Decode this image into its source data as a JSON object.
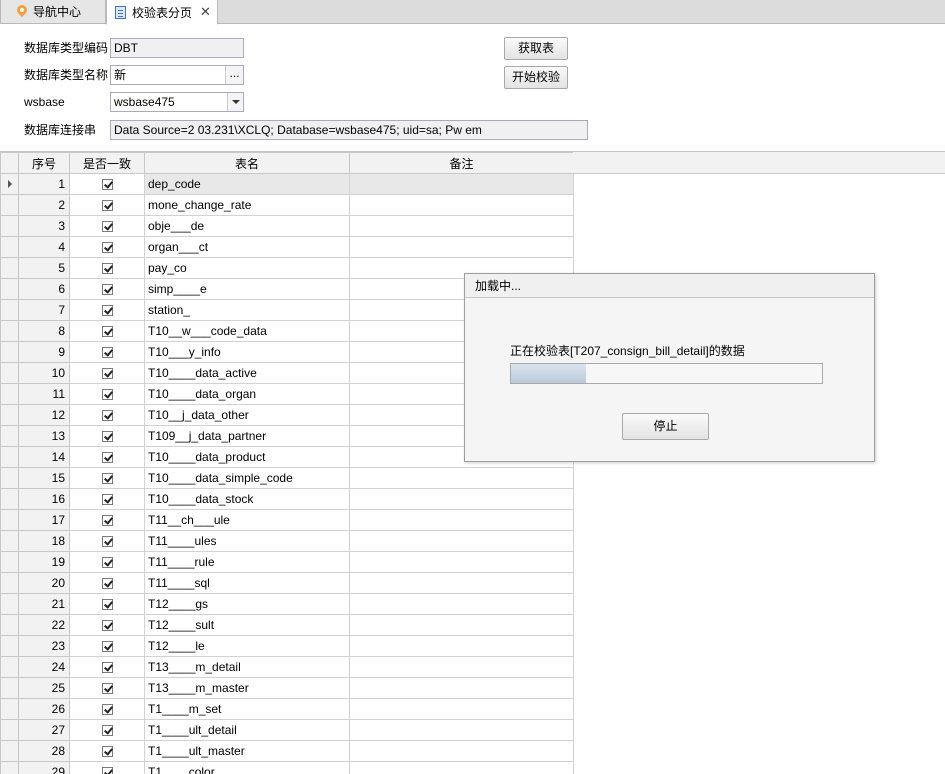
{
  "tabs": [
    {
      "label": "导航中心",
      "icon": "location-pin-icon",
      "active": false
    },
    {
      "label": "校验表分页",
      "icon": "document-icon",
      "active": true,
      "close": "✕"
    }
  ],
  "form": {
    "db_type_code_label": "数据库类型编码",
    "db_type_code_value": "DBT",
    "db_type_name_label": "数据库类型名称",
    "db_type_name_value": "新",
    "ellipsis": "...",
    "wsbase_label": "wsbase",
    "wsbase_value": "wsbase475",
    "conn_label": "数据库连接串",
    "conn_value": "Data Source=2          03.231\\XCLQ; Database=wsbase475; uid=sa; Pw           em",
    "get_tables_button": "获取表",
    "start_check_button": "开始校验"
  },
  "grid": {
    "columns": [
      "序号",
      "是否一致",
      "表名",
      "备注"
    ],
    "rows": [
      {
        "seq": "1",
        "name": "dep_code"
      },
      {
        "seq": "2",
        "name": "mone_change_rate"
      },
      {
        "seq": "3",
        "name": "obje___de"
      },
      {
        "seq": "4",
        "name": "organ___ct"
      },
      {
        "seq": "5",
        "name": "pay_co"
      },
      {
        "seq": "6",
        "name": "simp____e"
      },
      {
        "seq": "7",
        "name": "station_"
      },
      {
        "seq": "8",
        "name": "T10__w___code_data"
      },
      {
        "seq": "9",
        "name": "T10___y_info"
      },
      {
        "seq": "10",
        "name": "T10____data_active"
      },
      {
        "seq": "11",
        "name": "T10____data_organ"
      },
      {
        "seq": "12",
        "name": "T10__j_data_other"
      },
      {
        "seq": "13",
        "name": "T109__j_data_partner"
      },
      {
        "seq": "14",
        "name": "T10____data_product"
      },
      {
        "seq": "15",
        "name": "T10____data_simple_code"
      },
      {
        "seq": "16",
        "name": "T10____data_stock"
      },
      {
        "seq": "17",
        "name": "T11__ch___ule"
      },
      {
        "seq": "18",
        "name": "T11____ules"
      },
      {
        "seq": "19",
        "name": "T11____rule"
      },
      {
        "seq": "20",
        "name": "T11____sql"
      },
      {
        "seq": "21",
        "name": "T12____gs"
      },
      {
        "seq": "22",
        "name": "T12____sult"
      },
      {
        "seq": "23",
        "name": "T12____le"
      },
      {
        "seq": "24",
        "name": "T13____m_detail"
      },
      {
        "seq": "25",
        "name": "T13____m_master"
      },
      {
        "seq": "26",
        "name": "T1____m_set"
      },
      {
        "seq": "27",
        "name": "T1____ult_detail"
      },
      {
        "seq": "28",
        "name": "T1____ult_master"
      },
      {
        "seq": "29",
        "name": "T1____color"
      }
    ]
  },
  "dialog": {
    "title": "加载中...",
    "message": "正在校验表[T207_consign_bill_detail]的数据",
    "progress": 0.24,
    "stop_button": "停止"
  }
}
